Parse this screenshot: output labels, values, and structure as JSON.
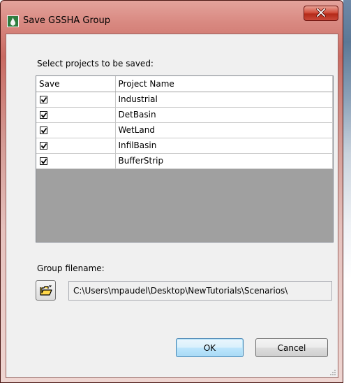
{
  "window": {
    "title": "Save GSSHA Group",
    "close_glyph": "x",
    "app_icon": "gssha-drop-icon"
  },
  "projects": {
    "prompt": "Select projects to be saved:",
    "columns": [
      "Save",
      "Project Name"
    ],
    "rows": [
      {
        "save": true,
        "name": "Industrial"
      },
      {
        "save": true,
        "name": "DetBasin"
      },
      {
        "save": true,
        "name": "WetLand"
      },
      {
        "save": true,
        "name": "InfilBasin"
      },
      {
        "save": true,
        "name": "BufferStrip"
      }
    ]
  },
  "group": {
    "label": "Group filename:",
    "browse_icon": "open-folder-icon",
    "filename": "C:\\Users\\mpaudel\\Desktop\\NewTutorials\\Scenarios\\"
  },
  "buttons": {
    "ok": "OK",
    "cancel": "Cancel"
  },
  "colors": {
    "titlebar": "#d98a82",
    "close_button": "#c9493a",
    "ok_border": "#3c7fb1",
    "grid_empty": "#a0a0a0"
  }
}
